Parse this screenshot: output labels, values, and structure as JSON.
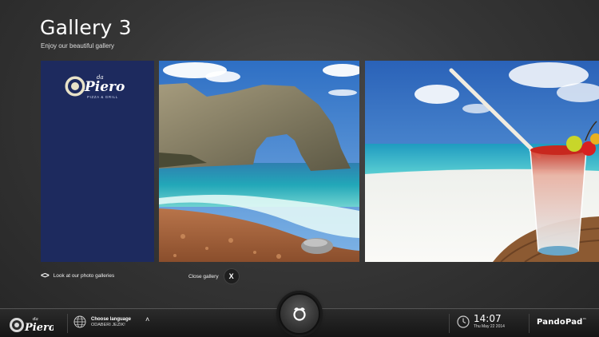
{
  "header": {
    "title": "Gallery 3",
    "subtitle": "Enjoy our beautiful gallery"
  },
  "logo": {
    "small_word": "da",
    "name": "Piero",
    "tagline": "PIZZA & GRILL"
  },
  "gallery": {
    "images": [
      {
        "name": "restaurant-logo-tile"
      },
      {
        "name": "rock-arch-beach-photo"
      },
      {
        "name": "tropical-beach-cocktail-photo"
      }
    ],
    "nav_label": "Look at our photo galleries",
    "close_label": "Close gallery",
    "close_glyph": "X"
  },
  "bottom_bar": {
    "logo_small": "da",
    "logo_name": "Piero",
    "language_title": "Choose language",
    "language_subtitle": "ODABERI JEZIK!",
    "time": "14:07",
    "date": "Thu May 22 2014",
    "brand": "PandoPad",
    "brand_mark": "™"
  },
  "colors": {
    "logo_tile": "#1d2a5e",
    "background": "#363636",
    "bar": "#151515"
  }
}
